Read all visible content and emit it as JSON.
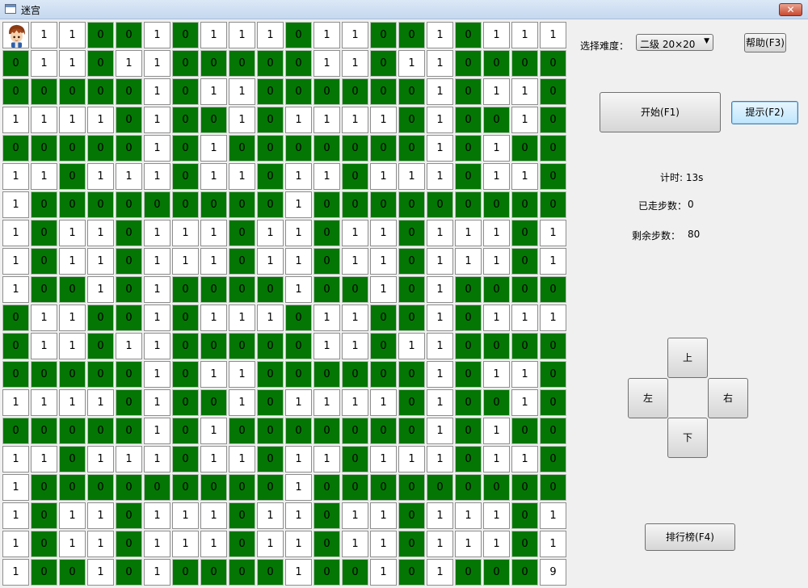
{
  "window": {
    "title": "迷宫",
    "close_glyph": "✕"
  },
  "controls": {
    "difficulty_label": "选择难度：",
    "difficulty_value": "二级 20×20",
    "help_button": "帮助(F3)",
    "start_button": "开始(F1)",
    "hint_button": "提示(F2)",
    "leaderboard_button": "排行榜(F4)"
  },
  "status": {
    "timer": "计时: 13s",
    "steps_label": "已走步数：",
    "steps_value": "0",
    "remaining_label": "剩余步数：",
    "remaining_value": "80"
  },
  "dpad": {
    "up": "上",
    "down": "下",
    "left": "左",
    "right": "右"
  },
  "maze": {
    "player_icon": "player-avatar-icon",
    "rows": [
      [
        "P",
        "1",
        "1",
        "0",
        "0",
        "1",
        "0",
        "1",
        "1",
        "1",
        "0",
        "1",
        "1",
        "0",
        "0",
        "1",
        "0",
        "1",
        "1",
        "1"
      ],
      [
        "0",
        "1",
        "1",
        "0",
        "1",
        "1",
        "0",
        "0",
        "0",
        "0",
        "0",
        "1",
        "1",
        "0",
        "1",
        "1",
        "0",
        "0",
        "0",
        "0"
      ],
      [
        "0",
        "0",
        "0",
        "0",
        "0",
        "1",
        "0",
        "1",
        "1",
        "0",
        "0",
        "0",
        "0",
        "0",
        "0",
        "1",
        "0",
        "1",
        "1",
        "0"
      ],
      [
        "1",
        "1",
        "1",
        "1",
        "0",
        "1",
        "0",
        "0",
        "1",
        "0",
        "1",
        "1",
        "1",
        "1",
        "0",
        "1",
        "0",
        "0",
        "1",
        "0"
      ],
      [
        "0",
        "0",
        "0",
        "0",
        "0",
        "1",
        "0",
        "1",
        "0",
        "0",
        "0",
        "0",
        "0",
        "0",
        "0",
        "1",
        "0",
        "1",
        "0",
        "0"
      ],
      [
        "1",
        "1",
        "0",
        "1",
        "1",
        "1",
        "0",
        "1",
        "1",
        "0",
        "1",
        "1",
        "0",
        "1",
        "1",
        "1",
        "0",
        "1",
        "1",
        "0"
      ],
      [
        "1",
        "0",
        "0",
        "0",
        "0",
        "0",
        "0",
        "0",
        "0",
        "0",
        "1",
        "0",
        "0",
        "0",
        "0",
        "0",
        "0",
        "0",
        "0",
        "0"
      ],
      [
        "1",
        "0",
        "1",
        "1",
        "0",
        "1",
        "1",
        "1",
        "0",
        "1",
        "1",
        "0",
        "1",
        "1",
        "0",
        "1",
        "1",
        "1",
        "0",
        "1"
      ],
      [
        "1",
        "0",
        "1",
        "1",
        "0",
        "1",
        "1",
        "1",
        "0",
        "1",
        "1",
        "0",
        "1",
        "1",
        "0",
        "1",
        "1",
        "1",
        "0",
        "1"
      ],
      [
        "1",
        "0",
        "0",
        "1",
        "0",
        "1",
        "0",
        "0",
        "0",
        "0",
        "1",
        "0",
        "0",
        "1",
        "0",
        "1",
        "0",
        "0",
        "0",
        "0"
      ],
      [
        "0",
        "1",
        "1",
        "0",
        "0",
        "1",
        "0",
        "1",
        "1",
        "1",
        "0",
        "1",
        "1",
        "0",
        "0",
        "1",
        "0",
        "1",
        "1",
        "1"
      ],
      [
        "0",
        "1",
        "1",
        "0",
        "1",
        "1",
        "0",
        "0",
        "0",
        "0",
        "0",
        "1",
        "1",
        "0",
        "1",
        "1",
        "0",
        "0",
        "0",
        "0"
      ],
      [
        "0",
        "0",
        "0",
        "0",
        "0",
        "1",
        "0",
        "1",
        "1",
        "0",
        "0",
        "0",
        "0",
        "0",
        "0",
        "1",
        "0",
        "1",
        "1",
        "0"
      ],
      [
        "1",
        "1",
        "1",
        "1",
        "0",
        "1",
        "0",
        "0",
        "1",
        "0",
        "1",
        "1",
        "1",
        "1",
        "0",
        "1",
        "0",
        "0",
        "1",
        "0"
      ],
      [
        "0",
        "0",
        "0",
        "0",
        "0",
        "1",
        "0",
        "1",
        "0",
        "0",
        "0",
        "0",
        "0",
        "0",
        "0",
        "1",
        "0",
        "1",
        "0",
        "0"
      ],
      [
        "1",
        "1",
        "0",
        "1",
        "1",
        "1",
        "0",
        "1",
        "1",
        "0",
        "1",
        "1",
        "0",
        "1",
        "1",
        "1",
        "0",
        "1",
        "1",
        "0"
      ],
      [
        "1",
        "0",
        "0",
        "0",
        "0",
        "0",
        "0",
        "0",
        "0",
        "0",
        "1",
        "0",
        "0",
        "0",
        "0",
        "0",
        "0",
        "0",
        "0",
        "0"
      ],
      [
        "1",
        "0",
        "1",
        "1",
        "0",
        "1",
        "1",
        "1",
        "0",
        "1",
        "1",
        "0",
        "1",
        "1",
        "0",
        "1",
        "1",
        "1",
        "0",
        "1"
      ],
      [
        "1",
        "0",
        "1",
        "1",
        "0",
        "1",
        "1",
        "1",
        "0",
        "1",
        "1",
        "0",
        "1",
        "1",
        "0",
        "1",
        "1",
        "1",
        "0",
        "1"
      ],
      [
        "1",
        "0",
        "0",
        "1",
        "0",
        "1",
        "0",
        "0",
        "0",
        "0",
        "1",
        "0",
        "0",
        "1",
        "0",
        "1",
        "0",
        "0",
        "0",
        "9"
      ]
    ]
  },
  "colors": {
    "wall": "#047604",
    "path": "#ffffff"
  }
}
